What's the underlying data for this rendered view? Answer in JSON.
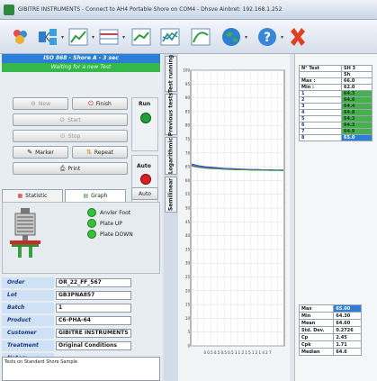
{
  "window": {
    "title": "GIBITRE INSTRUMENTS - Connect to AH4 Portable Shore on COM4 - Dhsve Ainbret: 192.168.1.252"
  },
  "toolbar": {
    "icons": [
      "people-icon",
      "network-icon",
      "chart-icon",
      "table-icon",
      "line-chart-icon",
      "multi-line-chart-icon",
      "curve-chart-icon",
      "globe-icon",
      "help-icon",
      "close-icon"
    ]
  },
  "header": {
    "test_title": "ISO 868 - Shore A - 3 sec",
    "status": "Waiting for a new Test"
  },
  "buttons": {
    "new": "New",
    "finish": "Finish",
    "start": "Start",
    "stop": "Stop",
    "marker": "Marker",
    "repeat": "Repeat",
    "print": "Print",
    "run": "Run",
    "auto_lbl": "Auto",
    "auto_btn": "Auto"
  },
  "tabs": {
    "statistic": "Statistic",
    "graph": "Graph"
  },
  "status": {
    "anvil": "Anvler Foot",
    "plate_up": "Plate UP",
    "plate_down": "Plate DOWN"
  },
  "info": {
    "order_key": "Order",
    "order": "OR_22_FF_567",
    "lot_key": "Lot",
    "lot": "GB3PNA857",
    "batch_key": "Batch",
    "batch": "1",
    "product_key": "Product",
    "product": "C6-PHA-64",
    "customer_key": "Customer",
    "customer": "GIBITRE INSTRUMENTS",
    "treatment_key": "Treatment",
    "treatment": "Original Conditions",
    "notes_key": "Notes:",
    "notes": "Tests on Standard Shore Sample"
  },
  "vtabs": {
    "test_running": "Test running",
    "previous_tests": "Previous tests",
    "logarithmic": "Logarithmic",
    "semilinear": "Semilinear"
  },
  "chart_data": {
    "type": "line",
    "y_ticks": [
      "100",
      "95",
      "90",
      "85",
      "80",
      "75",
      "70",
      "65",
      "60",
      "55",
      "50",
      "45",
      "40",
      "35",
      "30",
      "25",
      "20",
      "15",
      "10",
      "5",
      "0"
    ],
    "ylim": [
      0,
      100
    ],
    "x_tick_text": "0 0.5 0.5 0.5 0.5 1 1 2 1 5 1 2 1 4 2 7",
    "series": [
      {
        "color": "#2a55c8",
        "values": [
          66,
          65.4,
          65,
          64.8,
          64.6,
          64.4,
          64.3,
          64.2,
          64.1,
          64.0,
          64.0,
          63.9,
          63.9,
          63.8,
          63.8
        ]
      },
      {
        "color": "#8a2be2",
        "values": [
          65.6,
          65,
          64.7,
          64.5,
          64.3,
          64.2,
          64.1,
          64.0,
          63.9,
          63.9,
          63.8,
          63.8,
          63.7,
          63.7,
          63.7
        ]
      },
      {
        "color": "#2e9c3f",
        "values": [
          65.2,
          64.8,
          64.5,
          64.3,
          64.2,
          64.1,
          64.0,
          63.9,
          63.9,
          63.8,
          63.8,
          63.8,
          63.7,
          63.7,
          63.6
        ]
      }
    ]
  },
  "results": {
    "headers": [
      "N° Test",
      "SH 3",
      "Sh"
    ],
    "max_label": "Max :",
    "max": "66.0",
    "min_label": "Min :",
    "min": "62.0",
    "rows": [
      {
        "n": "1",
        "v": "64.3"
      },
      {
        "n": "2",
        "v": "64.6"
      },
      {
        "n": "3",
        "v": "64.4"
      },
      {
        "n": "4",
        "v": "64.8"
      },
      {
        "n": "5",
        "v": "64.3"
      },
      {
        "n": "6",
        "v": "64.3"
      },
      {
        "n": "7",
        "v": "64.9"
      },
      {
        "n": "8",
        "v": "65.0"
      }
    ]
  },
  "stats": [
    {
      "k": "Max",
      "v": "65.00"
    },
    {
      "k": "Min",
      "v": "64.30"
    },
    {
      "k": "Mean",
      "v": "64.60"
    },
    {
      "k": "Std. Dev.",
      "v": "0.2726"
    },
    {
      "k": "Cp",
      "v": "2.45"
    },
    {
      "k": "Cpk",
      "v": "1.71"
    },
    {
      "k": "Median",
      "v": "64.6"
    }
  ]
}
